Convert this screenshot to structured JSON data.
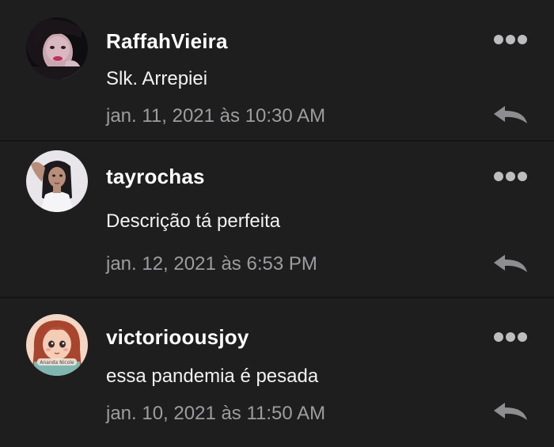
{
  "comments": [
    {
      "username": "RaffahVieira",
      "message": "Slk. Arrepiei",
      "timestamp": "jan. 11, 2021 às 10:30 AM",
      "avatar_icon": "user-photo-avatar",
      "more_icon": "more-options-icon",
      "reply_icon": "reply-icon"
    },
    {
      "username": "tayrochas",
      "message": "Descrição tá perfeita",
      "timestamp": "jan. 12, 2021 às 6:53 PM",
      "avatar_icon": "user-photo-avatar",
      "more_icon": "more-options-icon",
      "reply_icon": "reply-icon"
    },
    {
      "username": "victorioousjoy",
      "message": "essa pandemia é pesada",
      "timestamp": "jan. 10, 2021 às 11:50 AM",
      "avatar_icon": "user-illustration-avatar",
      "avatar_caption": "Ananda Nicole",
      "more_icon": "more-options-icon",
      "reply_icon": "reply-icon"
    }
  ],
  "colors": {
    "background": "#1e1e1f",
    "divider": "#141415",
    "username": "#ffffff",
    "message": "#f2f2f2",
    "timestamp": "#9d9d9f",
    "icon": "#9a9a9c"
  }
}
